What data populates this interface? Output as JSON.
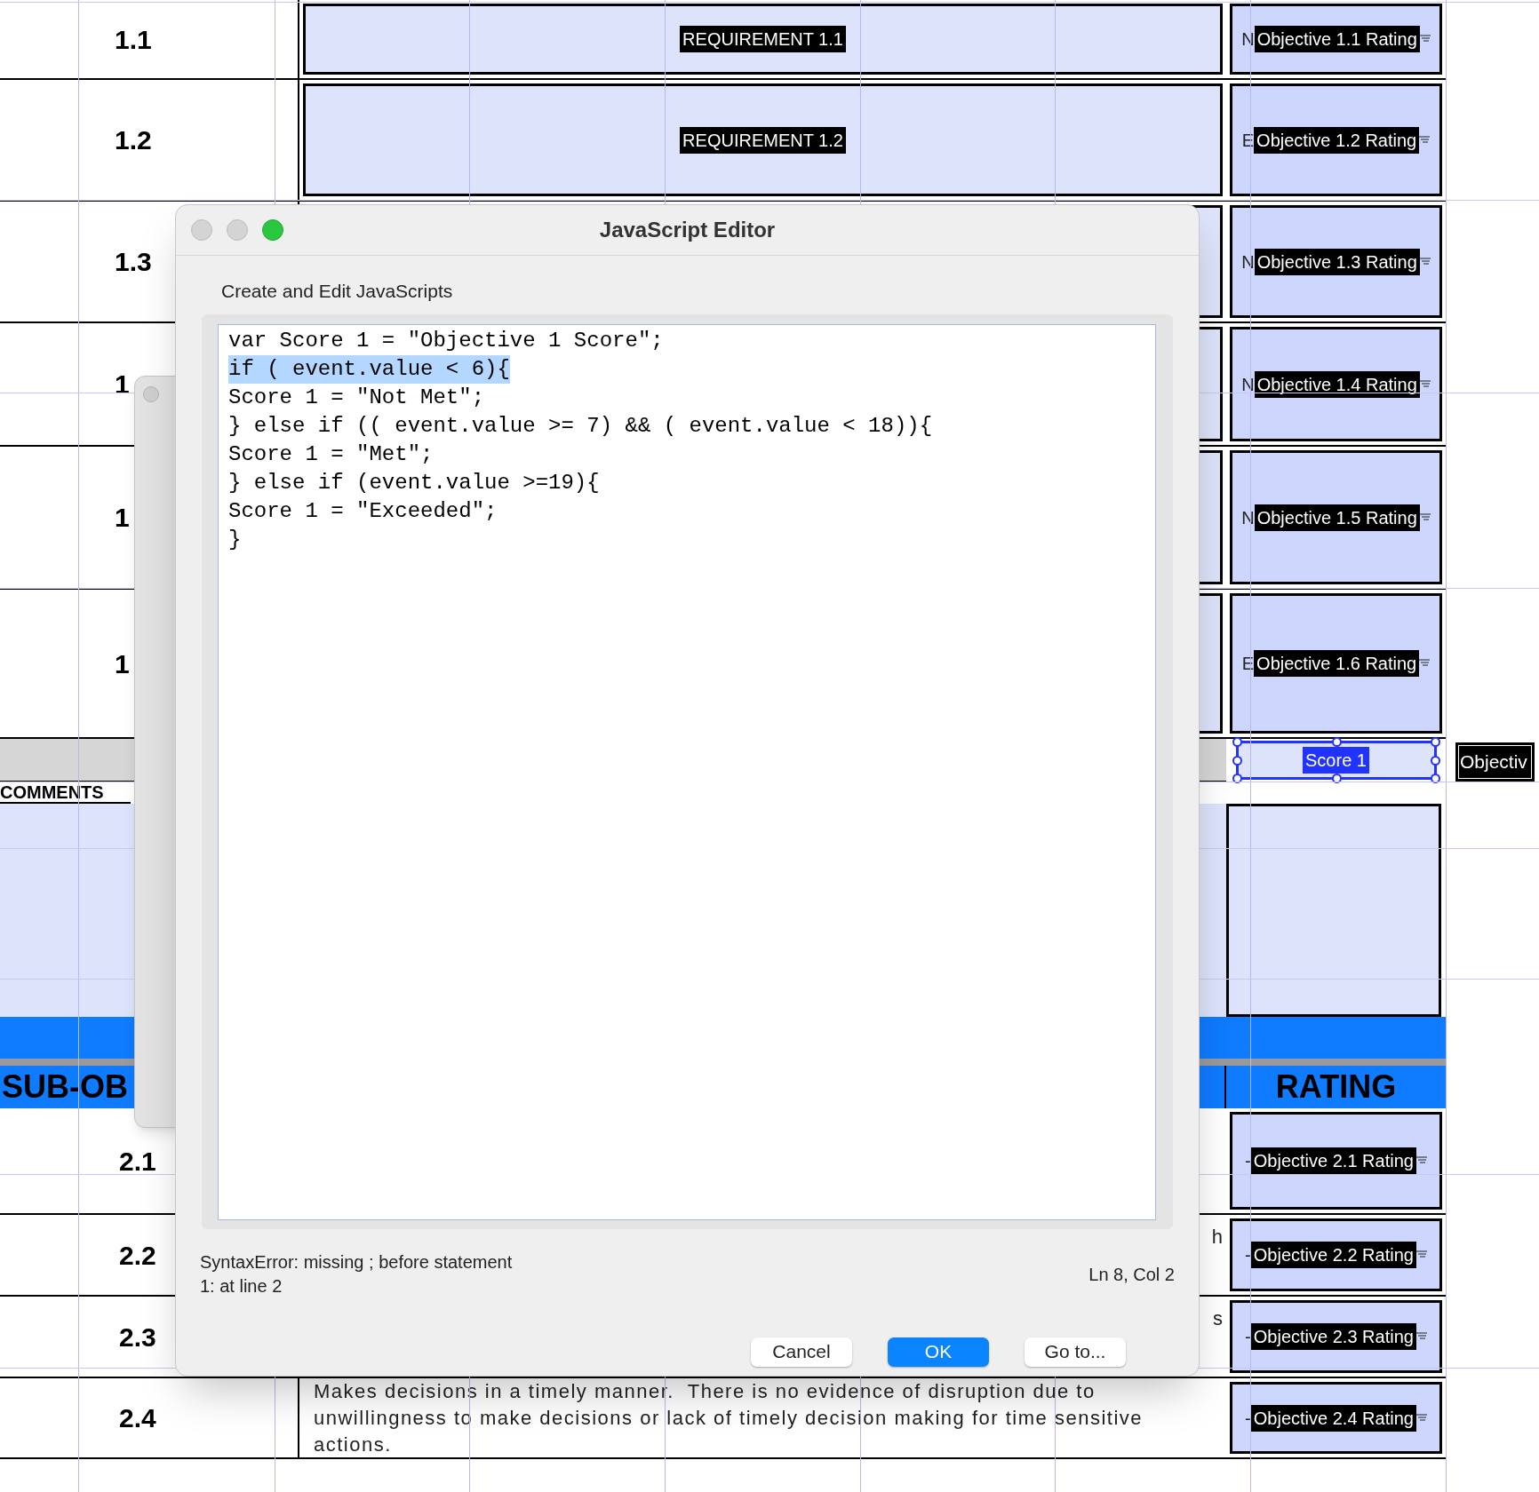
{
  "form": {
    "objective_rows": [
      {
        "number": "1.1",
        "requirement": "REQUIREMENT 1.1",
        "rating_prefix": "N",
        "rating": "Objective 1.1 Rating"
      },
      {
        "number": "1.2",
        "requirement": "REQUIREMENT 1.2",
        "rating_prefix": "E",
        "rating": "Objective 1.2 Rating"
      },
      {
        "number": "1.3",
        "rating_prefix": "N",
        "rating": "Objective 1.3 Rating"
      },
      {
        "number": "1",
        "rating_prefix": "N",
        "rating": "Objective 1.4 Rating"
      },
      {
        "number": "1",
        "rating_prefix": "N",
        "rating": "Objective 1.5 Rating"
      },
      {
        "number": "1",
        "rating_prefix": "E",
        "rating": "Objective 1.6 Rating"
      }
    ],
    "score_field": {
      "value": "Score 1",
      "selected": true
    },
    "side_field": "Objectiv",
    "comments_label": "COMMENTS",
    "section_header": {
      "column_1": "SUB-OB",
      "column_3": "RATING"
    },
    "sub_rows": [
      {
        "number": "2.1",
        "rating_prefix": "-",
        "rating": "Objective 2.1 Rating"
      },
      {
        "number": "2.2",
        "kind": "line_end",
        "requirement": "h",
        "rating_prefix": "-",
        "rating": "Objective 2.2 Rating"
      },
      {
        "number": "2.3",
        "kind": "line_end",
        "requirement": "s",
        "rating_prefix": "-",
        "rating": "Objective 2.3 Rating"
      },
      {
        "number": "2.4",
        "kind": "paragraph",
        "requirement": "Makes decisions in a timely manner.  There is no evidence of disruption due to unwillingness to make decisions or lack of timely decision making for time sensitive actions.",
        "rating_prefix": "-",
        "rating": "Objective 2.4 Rating"
      }
    ]
  },
  "dialog": {
    "title": "JavaScript Editor",
    "label": "Create and Edit JavaScripts",
    "code_lines": [
      {
        "text": "var Score 1 = \"Objective 1 Score\";",
        "selected": false
      },
      {
        "text": "if ( event.value < 6){",
        "selected": true
      },
      {
        "text": "Score 1 = \"Not Met\";",
        "selected": false
      },
      {
        "text": "} else if (( event.value >= 7) && ( event.value < 18)){",
        "selected": false
      },
      {
        "text": "Score 1 = \"Met\";",
        "selected": false
      },
      {
        "text": "} else if (event.value >=19){",
        "selected": false
      },
      {
        "text": "Score 1 = \"Exceeded\";",
        "selected": false
      },
      {
        "text": "}",
        "selected": false
      }
    ],
    "error_lines": [
      "SyntaxError: missing ; before statement",
      "1: at line 2"
    ],
    "cursor_position": "Ln 8, Col 2",
    "buttons": [
      {
        "label": "Cancel",
        "kind": "secondary"
      },
      {
        "label": "OK",
        "kind": "primary"
      },
      {
        "label": "Go to...",
        "kind": "secondary"
      }
    ]
  }
}
